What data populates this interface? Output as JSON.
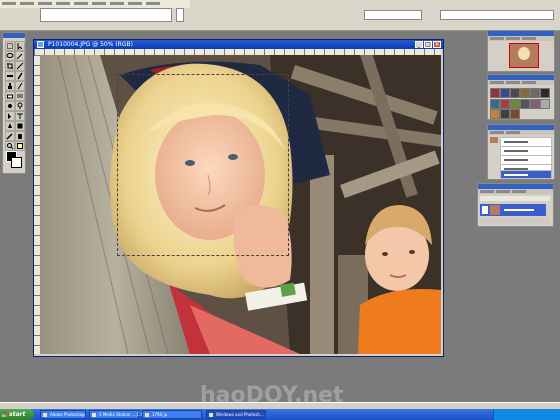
{
  "document": {
    "title": "P1010004.JPG @ 50% (RGB)",
    "minimize_glyph": "_",
    "maximize_glyph": "□",
    "close_glyph": "×"
  },
  "taskbar": {
    "start_label": "start",
    "tasks": [
      {
        "label": "Adobe Photoshop",
        "active": false
      },
      {
        "label": "5 Media Station ... C:\\...",
        "active": false
      },
      {
        "label": "1760.jp",
        "active": false
      },
      {
        "label": "Windows and Photosh...",
        "active": true
      }
    ]
  },
  "watermark": {
    "text": "haoDOY.net"
  },
  "icons": {
    "toolbox": [
      "marquee-icon",
      "move-icon",
      "lasso-icon",
      "magic-wand-icon",
      "crop-icon",
      "slice-icon",
      "healing-brush-icon",
      "brush-icon",
      "clone-stamp-icon",
      "history-brush-icon",
      "eraser-icon",
      "gradient-icon",
      "blur-icon",
      "dodge-icon",
      "path-select-icon",
      "type-icon",
      "pen-icon",
      "shape-icon",
      "notes-icon",
      "eyedropper-icon",
      "hand-icon",
      "zoom-icon"
    ]
  },
  "colors": {
    "title_bar": "#0a3bb5",
    "workspace": "#7b7b7b",
    "active_history": "#3a5fcd",
    "taskbar": "#1c4fc6",
    "start_button": "#2e7d2e"
  }
}
